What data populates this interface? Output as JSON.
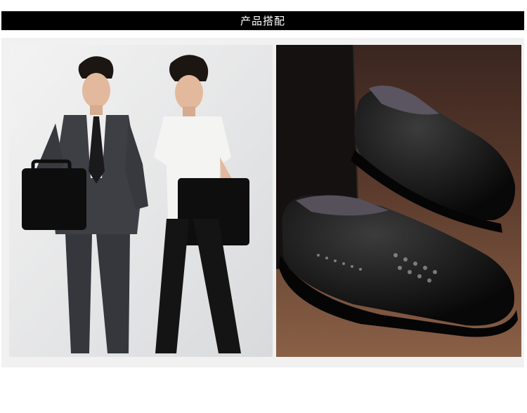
{
  "section_title": "产品搭配",
  "images": [
    {
      "name": "two-men-suits-photo"
    },
    {
      "name": "black-leather-shoes-photo"
    }
  ],
  "colors": {
    "title_bar": "#000000",
    "title_text": "#ffffff",
    "frame": "#f1f1f1"
  }
}
